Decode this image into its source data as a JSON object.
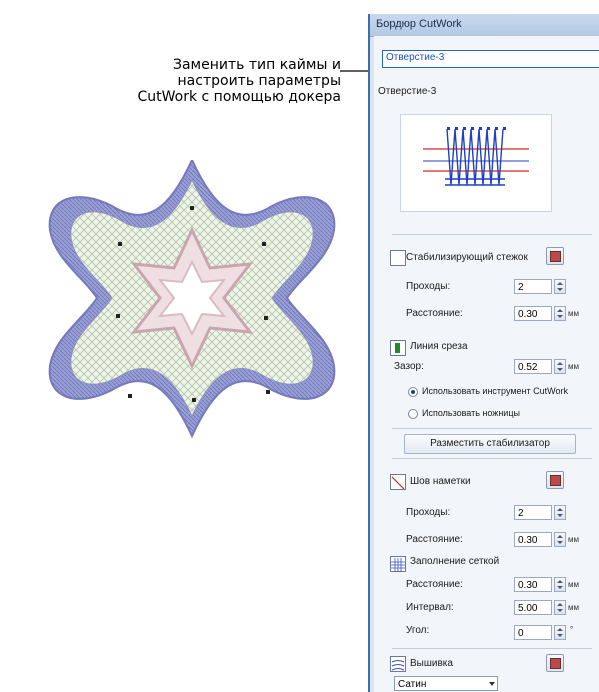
{
  "callout": {
    "lines": [
      "Заменить тип каймы и",
      "настроить параметры",
      "CutWork с помощью докера"
    ]
  },
  "docker": {
    "title": "Бордюр CutWork",
    "selected_type": "Отверстие-3",
    "type_label": "Отверстие-3",
    "stabilizer": {
      "label": "Стабилизирующий стежок",
      "passes_label": "Проходы:",
      "passes_value": "2",
      "distance_label": "Расстояние:",
      "distance_value": "0.30",
      "unit": "мм"
    },
    "cutline": {
      "label": "Линия среза",
      "gap_label": "Зазор:",
      "gap_value": "0.52",
      "unit": "мм",
      "option_tool": "Использовать инструмент CutWork",
      "option_scissors": "Использовать ножницы",
      "selected_option": "tool"
    },
    "place_stabilizer_button": "Разместить стабилизатор",
    "tack": {
      "label": "Шов наметки",
      "passes_label": "Проходы:",
      "passes_value": "2",
      "distance_label": "Расстояние:",
      "distance_value": "0.30",
      "unit": "мм"
    },
    "grid": {
      "label": "Заполнение сеткой",
      "distance_label": "Расстояние:",
      "distance_value": "0.30",
      "interval_label": "Интервал:",
      "interval_value": "5.00",
      "angle_label": "Угол:",
      "angle_value": "0",
      "unit_mm": "мм",
      "unit_deg": "°"
    },
    "embroidery": {
      "label": "Вышивка",
      "stitch_type": "Сатин"
    }
  },
  "colors": {
    "accent": "#2a62c9",
    "border_outline": "#8f93cc",
    "fill_green": "#e5efdf",
    "star_pink": "#e8cfd3"
  }
}
